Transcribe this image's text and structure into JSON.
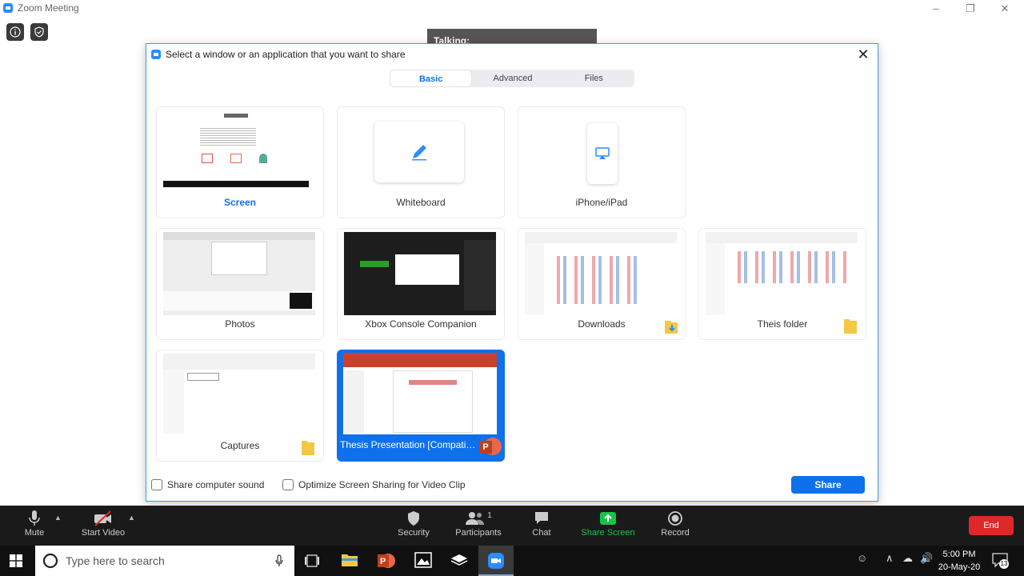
{
  "app": {
    "title": "Zoom Meeting"
  },
  "talking": "Talking:",
  "dialog": {
    "title": "Select a window or an application that you want to share",
    "tabs": [
      {
        "label": "Basic",
        "active": true
      },
      {
        "label": "Advanced",
        "active": false
      },
      {
        "label": "Files",
        "active": false
      }
    ],
    "items": [
      {
        "label": "Screen"
      },
      {
        "label": "Whiteboard"
      },
      {
        "label": "iPhone/iPad"
      },
      {
        "label": "Photos"
      },
      {
        "label": "Xbox Console Companion"
      },
      {
        "label": "Downloads"
      },
      {
        "label": "Theis folder"
      },
      {
        "label": "Captures"
      },
      {
        "label": "Thesis Presentation [Compatibility Mode]"
      }
    ],
    "share_sound_label": "Share computer sound",
    "optimize_label": "Optimize Screen Sharing for Video Clip",
    "share_button": "Share"
  },
  "toolbar": {
    "mute": "Mute",
    "start_video": "Start Video",
    "security": "Security",
    "participants": "Participants",
    "participants_count": "1",
    "chat": "Chat",
    "share_screen": "Share Screen",
    "record": "Record",
    "end": "End"
  },
  "taskbar": {
    "search_placeholder": "Type here to search",
    "time": "5:00 PM",
    "date": "20-May-20",
    "notification_count": "13"
  },
  "colors": {
    "accent": "#0e71eb",
    "share_green": "#17c34a",
    "end_red": "#e02828",
    "toolbar_bg": "#1a1a1a"
  }
}
